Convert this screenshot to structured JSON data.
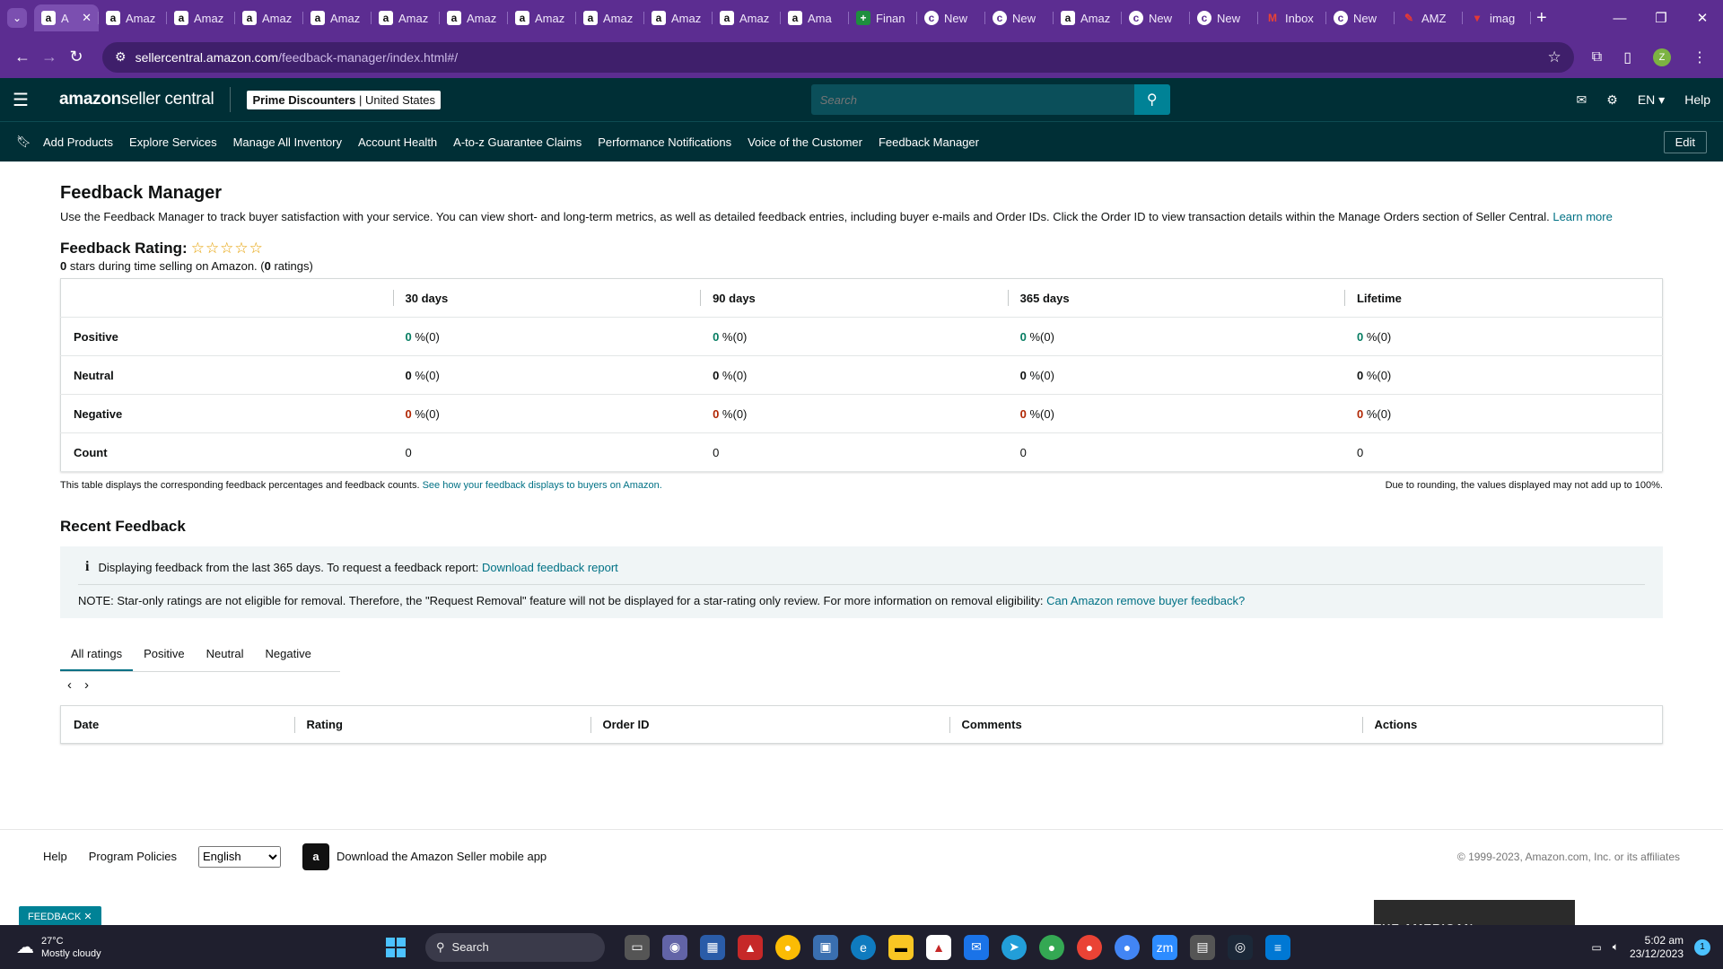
{
  "browser": {
    "tabs": [
      {
        "fav": "a",
        "title": "A",
        "active": true
      },
      {
        "fav": "a",
        "title": "Amaz"
      },
      {
        "fav": "a",
        "title": "Amaz"
      },
      {
        "fav": "a",
        "title": "Amaz"
      },
      {
        "fav": "a",
        "title": "Amaz"
      },
      {
        "fav": "a",
        "title": "Amaz"
      },
      {
        "fav": "a",
        "title": "Amaz"
      },
      {
        "fav": "a",
        "title": "Amaz"
      },
      {
        "fav": "a",
        "title": "Amaz"
      },
      {
        "fav": "a",
        "title": "Amaz"
      },
      {
        "fav": "a",
        "title": "Amaz"
      },
      {
        "fav": "a",
        "title": "Ama"
      },
      {
        "fav": "+",
        "title": "Finan"
      },
      {
        "fav": "c",
        "title": "New"
      },
      {
        "fav": "c",
        "title": "New"
      },
      {
        "fav": "a",
        "title": "Amaz"
      },
      {
        "fav": "c",
        "title": "New"
      },
      {
        "fav": "c",
        "title": "New"
      },
      {
        "fav": "M",
        "title": "Inbox"
      },
      {
        "fav": "c",
        "title": "New"
      },
      {
        "fav": "✎",
        "title": "AMZ"
      },
      {
        "fav": "▾",
        "title": "imag"
      }
    ],
    "url_host": "sellercentral.amazon.com",
    "url_path": "/feedback-manager/index.html#/",
    "profile_initial": "Z"
  },
  "header": {
    "logo_bold": "amazon",
    "logo_rest": " seller central",
    "account_name": "Prime Discounters",
    "account_region": "United States",
    "search_placeholder": "Search",
    "lang": "EN ▾",
    "help": "Help"
  },
  "nav": {
    "items": [
      "Add Products",
      "Explore Services",
      "Manage All Inventory",
      "Account Health",
      "A-to-z Guarantee Claims",
      "Performance Notifications",
      "Voice of the Customer",
      "Feedback Manager"
    ],
    "edit": "Edit"
  },
  "page": {
    "title": "Feedback Manager",
    "intro": "Use the Feedback Manager to track buyer satisfaction with your service. You can view short- and long-term metrics, as well as detailed feedback entries, including buyer e-mails and Order IDs. Click the Order ID to view transaction details within the Manage Orders section of Seller Central.",
    "learn_more": "Learn more",
    "rating_label": "Feedback Rating:",
    "stars": "☆☆☆☆☆",
    "stars_value": 0,
    "rating_count": "0",
    "rating_sub_mid": " stars during time selling on Amazon. (",
    "rating_count_n": "0",
    "rating_sub_end": " ratings)"
  },
  "metrics": {
    "columns": [
      "30 days",
      "90 days",
      "365 days",
      "Lifetime"
    ],
    "rows": [
      {
        "label": "Positive",
        "type": "pos",
        "values": [
          "0",
          "0",
          "0",
          "0"
        ],
        "suffix": " %(0)"
      },
      {
        "label": "Neutral",
        "type": "neu",
        "values": [
          "0",
          "0",
          "0",
          "0"
        ],
        "suffix": " %(0)"
      },
      {
        "label": "Negative",
        "type": "neg",
        "values": [
          "0",
          "0",
          "0",
          "0"
        ],
        "suffix": " %(0)"
      },
      {
        "label": "Count",
        "type": "count",
        "values": [
          "0",
          "0",
          "0",
          "0"
        ],
        "suffix": ""
      }
    ],
    "note_left": "This table displays the corresponding feedback percentages and feedback counts. ",
    "note_link": "See how your feedback displays to buyers on Amazon.",
    "note_right": "Due to rounding, the values displayed may not add up to 100%."
  },
  "recent": {
    "title": "Recent Feedback",
    "info_text": "Displaying feedback from the last 365 days. To request a feedback report: ",
    "info_link": "Download feedback report",
    "note_text": "NOTE: Star-only ratings are not eligible for removal. Therefore, the \"Request Removal\" feature will not be displayed for a star-rating only review. For more information on removal eligibility: ",
    "note_link": "Can Amazon remove buyer feedback?",
    "tabs": [
      "All ratings",
      "Positive",
      "Neutral",
      "Negative"
    ],
    "columns": [
      "Date",
      "Rating",
      "Order ID",
      "Comments",
      "Actions"
    ]
  },
  "footer": {
    "help": "Help",
    "policies": "Program Policies",
    "language": "English",
    "app_text": "Download the Amazon Seller mobile app",
    "copyright": "© 1999-2023, Amazon.com, Inc. or its affiliates",
    "feedback_tag": "FEEDBACK ✕"
  },
  "taskbar": {
    "temp": "27°C",
    "weather": "Mostly cloudy",
    "search": "Search",
    "time": "5:02 am",
    "date": "23/12/2023",
    "notif_count": "1",
    "promo": "THE AMERICAN WHOLESALERS"
  }
}
